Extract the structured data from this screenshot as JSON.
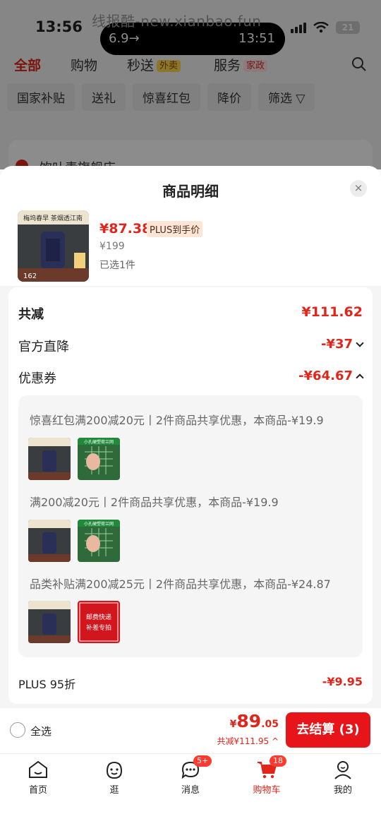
{
  "status": {
    "time": "13:56",
    "island_left": "6.9→",
    "island_right": "13:51",
    "battery": "21",
    "watermark": "线报酷-new.xianbao.fun"
  },
  "nav": {
    "tabs": [
      {
        "label": "全部"
      },
      {
        "label": "购物"
      },
      {
        "label": "秒送",
        "tag": "外卖"
      },
      {
        "label": "服务",
        "tag": "家政"
      }
    ]
  },
  "chips": [
    "国家补贴",
    "送礼",
    "惊喜红包",
    "降价",
    "筛选"
  ],
  "store": {
    "name": "饮叶素旗舰店"
  },
  "sheet": {
    "title": "商品明细",
    "close": "×",
    "product": {
      "price": "¥87.38",
      "plus_tag": "PLUS到手价",
      "original": "¥199",
      "selected": "已选1件",
      "img_text": "梅坞春早 茶烟透江南",
      "img_badge": "162"
    },
    "total_label": "共减",
    "total_value": "¥111.62",
    "official_label": "官方直降",
    "official_value": "-¥37",
    "coupon_label": "优惠券",
    "coupon_value": "-¥64.67",
    "coupons": [
      {
        "text": "惊喜红包满200减20元丨2件商品共享优惠，本商品-¥19.9"
      },
      {
        "text": "满200减20元丨2件商品共享优惠，本商品-¥19.9"
      },
      {
        "text": "品类补贴满200减25元丨2件商品共享优惠，本商品-¥24.87"
      }
    ],
    "net_label": "小孔硬塑荷兰网",
    "postage_line1": "邮费快递",
    "postage_line2": "补差专拍",
    "plus_label": "PLUS 95折",
    "plus_value": "-¥9.95"
  },
  "bottom": {
    "select_all": "全选",
    "price_cur": "¥",
    "price_int": "89",
    "price_dec": ".05",
    "reduced": "共减¥111.95",
    "checkout": "去结算 (3)"
  },
  "tabbar": [
    {
      "label": "首页"
    },
    {
      "label": "逛"
    },
    {
      "label": "消息",
      "badge": "5+"
    },
    {
      "label": "购物车",
      "badge": "18"
    },
    {
      "label": "我的"
    }
  ],
  "colors": {
    "accent": "#e1251b",
    "checkout": "#e7141a"
  }
}
